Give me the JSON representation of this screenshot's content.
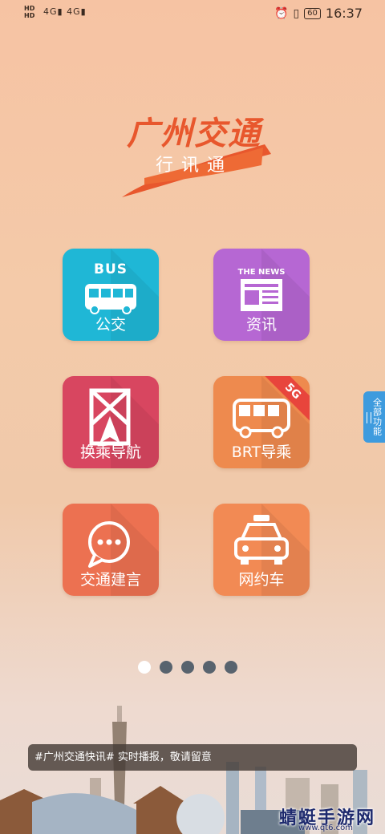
{
  "status_bar": {
    "hd1": "HD",
    "hd2": "HD",
    "signal1": "4G",
    "signal2": "4G",
    "battery": "60",
    "time": "16:37"
  },
  "logo": {
    "title": "广州交通",
    "subtitle": "行讯通"
  },
  "tiles": [
    {
      "id": "bus",
      "label": "公交",
      "caption": "BUS",
      "color": "#1fb7d6"
    },
    {
      "id": "news",
      "label": "资讯",
      "caption": "THE NEWS",
      "color": "#b667d3"
    },
    {
      "id": "nav",
      "label": "换乘导航",
      "color": "#d84660"
    },
    {
      "id": "brt",
      "label": "BRT导乘",
      "badge": "5G",
      "color": "#ee8a4e"
    },
    {
      "id": "advice",
      "label": "交通建言",
      "color": "#ec7151"
    },
    {
      "id": "taxi",
      "label": "网约车",
      "color": "#f28a54"
    }
  ],
  "side_tab": {
    "label": "全部功能"
  },
  "pagination": {
    "count": 5,
    "active": 1
  },
  "news_ticker": "#广州交通快讯# 实时播报，敬请留意",
  "watermark": {
    "text": "蜻蜓手游网",
    "url": "www.qt6.com"
  }
}
